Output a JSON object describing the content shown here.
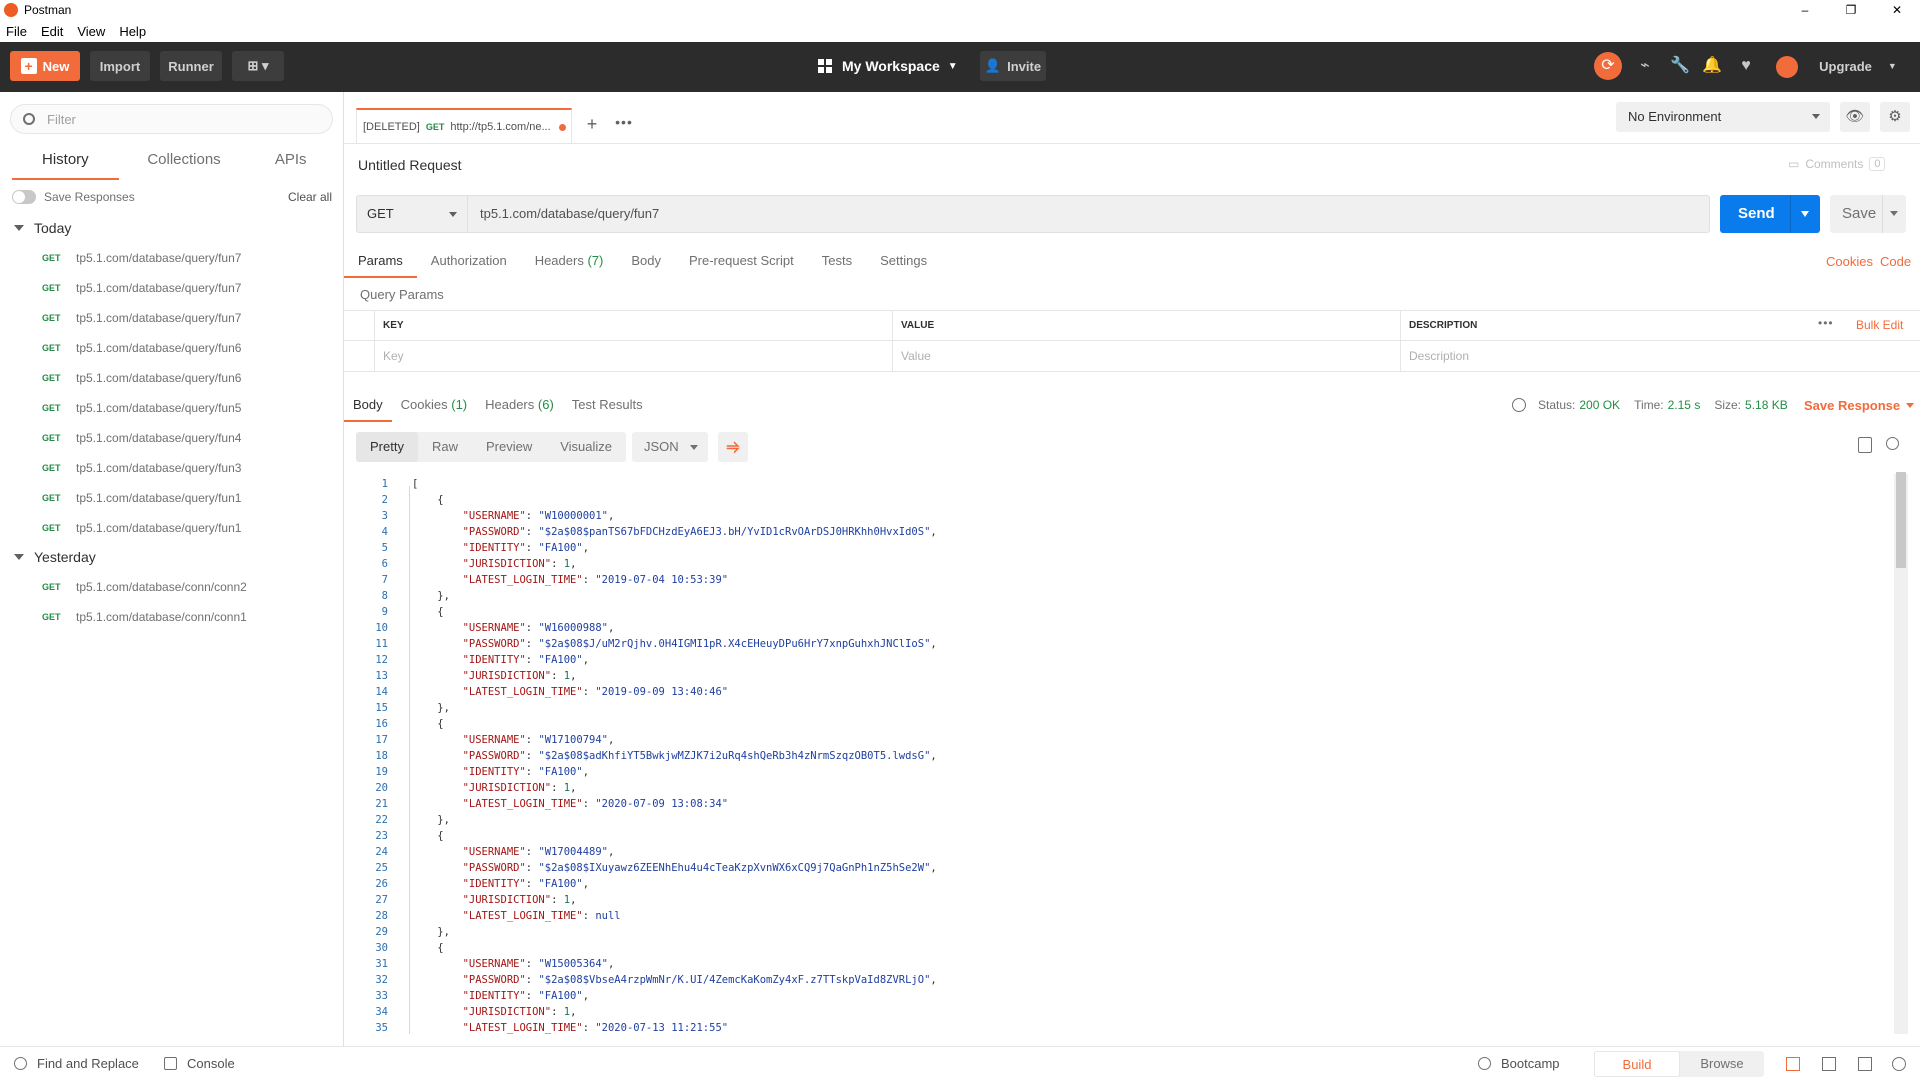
{
  "window": {
    "title": "Postman",
    "min": "–",
    "restore": "❐",
    "close": "✕"
  },
  "menu": [
    "File",
    "Edit",
    "View",
    "Help"
  ],
  "toolbar": {
    "new_label": "New",
    "import_label": "Import",
    "runner_label": "Runner",
    "workspace_label": "My Workspace",
    "invite_label": "Invite",
    "upgrade_label": "Upgrade"
  },
  "sidebar": {
    "filter_placeholder": "Filter",
    "tabs": [
      "History",
      "Collections",
      "APIs"
    ],
    "active_tab": "History",
    "save_responses_label": "Save Responses",
    "clear_all_label": "Clear all",
    "groups": [
      {
        "label": "Today",
        "items": [
          {
            "method": "GET",
            "url": "tp5.1.com/database/query/fun7"
          },
          {
            "method": "GET",
            "url": "tp5.1.com/database/query/fun7"
          },
          {
            "method": "GET",
            "url": "tp5.1.com/database/query/fun7"
          },
          {
            "method": "GET",
            "url": "tp5.1.com/database/query/fun6"
          },
          {
            "method": "GET",
            "url": "tp5.1.com/database/query/fun6"
          },
          {
            "method": "GET",
            "url": "tp5.1.com/database/query/fun5"
          },
          {
            "method": "GET",
            "url": "tp5.1.com/database/query/fun4"
          },
          {
            "method": "GET",
            "url": "tp5.1.com/database/query/fun3"
          },
          {
            "method": "GET",
            "url": "tp5.1.com/database/query/fun1"
          },
          {
            "method": "GET",
            "url": "tp5.1.com/database/query/fun1"
          }
        ]
      },
      {
        "label": "Yesterday",
        "items": [
          {
            "method": "GET",
            "url": "tp5.1.com/database/conn/conn2"
          },
          {
            "method": "GET",
            "url": "tp5.1.com/database/conn/conn1"
          }
        ]
      }
    ]
  },
  "request_tab": {
    "prefix": "[DELETED]",
    "method": "GET",
    "url": "http://tp5.1.com/ne..."
  },
  "environment": {
    "selected": "No Environment"
  },
  "request": {
    "title": "Untitled Request",
    "comments_label": "Comments",
    "comments_count": "0",
    "method": "GET",
    "url": "tp5.1.com/database/query/fun7",
    "send_label": "Send",
    "save_label": "Save"
  },
  "request_tabs": [
    {
      "label": "Params",
      "count": ""
    },
    {
      "label": "Authorization",
      "count": ""
    },
    {
      "label": "Headers",
      "count": "(7)"
    },
    {
      "label": "Body",
      "count": ""
    },
    {
      "label": "Pre-request Script",
      "count": ""
    },
    {
      "label": "Tests",
      "count": ""
    },
    {
      "label": "Settings",
      "count": ""
    }
  ],
  "links": {
    "cookies": "Cookies",
    "code": "Code",
    "bulk_edit": "Bulk Edit"
  },
  "query_params": {
    "title": "Query Params",
    "headers": [
      "KEY",
      "VALUE",
      "DESCRIPTION"
    ],
    "placeholders": [
      "Key",
      "Value",
      "Description"
    ]
  },
  "response": {
    "tabs": [
      {
        "label": "Body",
        "count": ""
      },
      {
        "label": "Cookies",
        "count": "(1)"
      },
      {
        "label": "Headers",
        "count": "(6)"
      },
      {
        "label": "Test Results",
        "count": ""
      }
    ],
    "status_label": "Status:",
    "status_value": "200 OK",
    "time_label": "Time:",
    "time_value": "2.15 s",
    "size_label": "Size:",
    "size_value": "5.18 KB",
    "save_response_label": "Save Response",
    "view_modes": [
      "Pretty",
      "Raw",
      "Preview",
      "Visualize"
    ],
    "format": "JSON"
  },
  "body_lines": [
    "[",
    "    {",
    "        \"USERNAME\": \"W10000001\",",
    "        \"PASSWORD\": \"$2a$08$panTS67bFDCHzdEyA6EJ3.bH/YvID1cRvOArDSJ0HRKhh0HvxId0S\",",
    "        \"IDENTITY\": \"FA100\",",
    "        \"JURISDICTION\": 1,",
    "        \"LATEST_LOGIN_TIME\": \"2019-07-04 10:53:39\"",
    "    },",
    "    {",
    "        \"USERNAME\": \"W16000988\",",
    "        \"PASSWORD\": \"$2a$08$J/uM2rQjhv.0H4IGMI1pR.X4cEHeuyDPu6HrY7xnpGuhxhJNClIoS\",",
    "        \"IDENTITY\": \"FA100\",",
    "        \"JURISDICTION\": 1,",
    "        \"LATEST_LOGIN_TIME\": \"2019-09-09 13:40:46\"",
    "    },",
    "    {",
    "        \"USERNAME\": \"W17100794\",",
    "        \"PASSWORD\": \"$2a$08$adKhfiYT5BwkjwMZJK7i2uRq4shQeRb3h4zNrmSzqzOB0T5.lwdsG\",",
    "        \"IDENTITY\": \"FA100\",",
    "        \"JURISDICTION\": 1,",
    "        \"LATEST_LOGIN_TIME\": \"2020-07-09 13:08:34\"",
    "    },",
    "    {",
    "        \"USERNAME\": \"W17004489\",",
    "        \"PASSWORD\": \"$2a$08$IXuyawz6ZEENhEhu4u4cTeaKzpXvnWX6xCQ9j7QaGnPh1nZ5hSe2W\",",
    "        \"IDENTITY\": \"FA100\",",
    "        \"JURISDICTION\": 1,",
    "        \"LATEST_LOGIN_TIME\": null",
    "    },",
    "    {",
    "        \"USERNAME\": \"W15005364\",",
    "        \"PASSWORD\": \"$2a$08$VbseA4rzpWmNr/K.UI/4ZemcKaKomZy4xF.z7TTskpVaId8ZVRLjO\",",
    "        \"IDENTITY\": \"FA100\",",
    "        \"JURISDICTION\": 1,",
    "        \"LATEST_LOGIN_TIME\": \"2020-07-13 11:21:55\""
  ],
  "statusbar": {
    "find_replace": "Find and Replace",
    "console": "Console",
    "bootcamp": "Bootcamp",
    "build": "Build",
    "browse": "Browse"
  },
  "colors": {
    "accent": "#f26b3a",
    "send": "#097bed",
    "method_get": "#248c46",
    "toolbar_bg": "#2c2c2c"
  }
}
